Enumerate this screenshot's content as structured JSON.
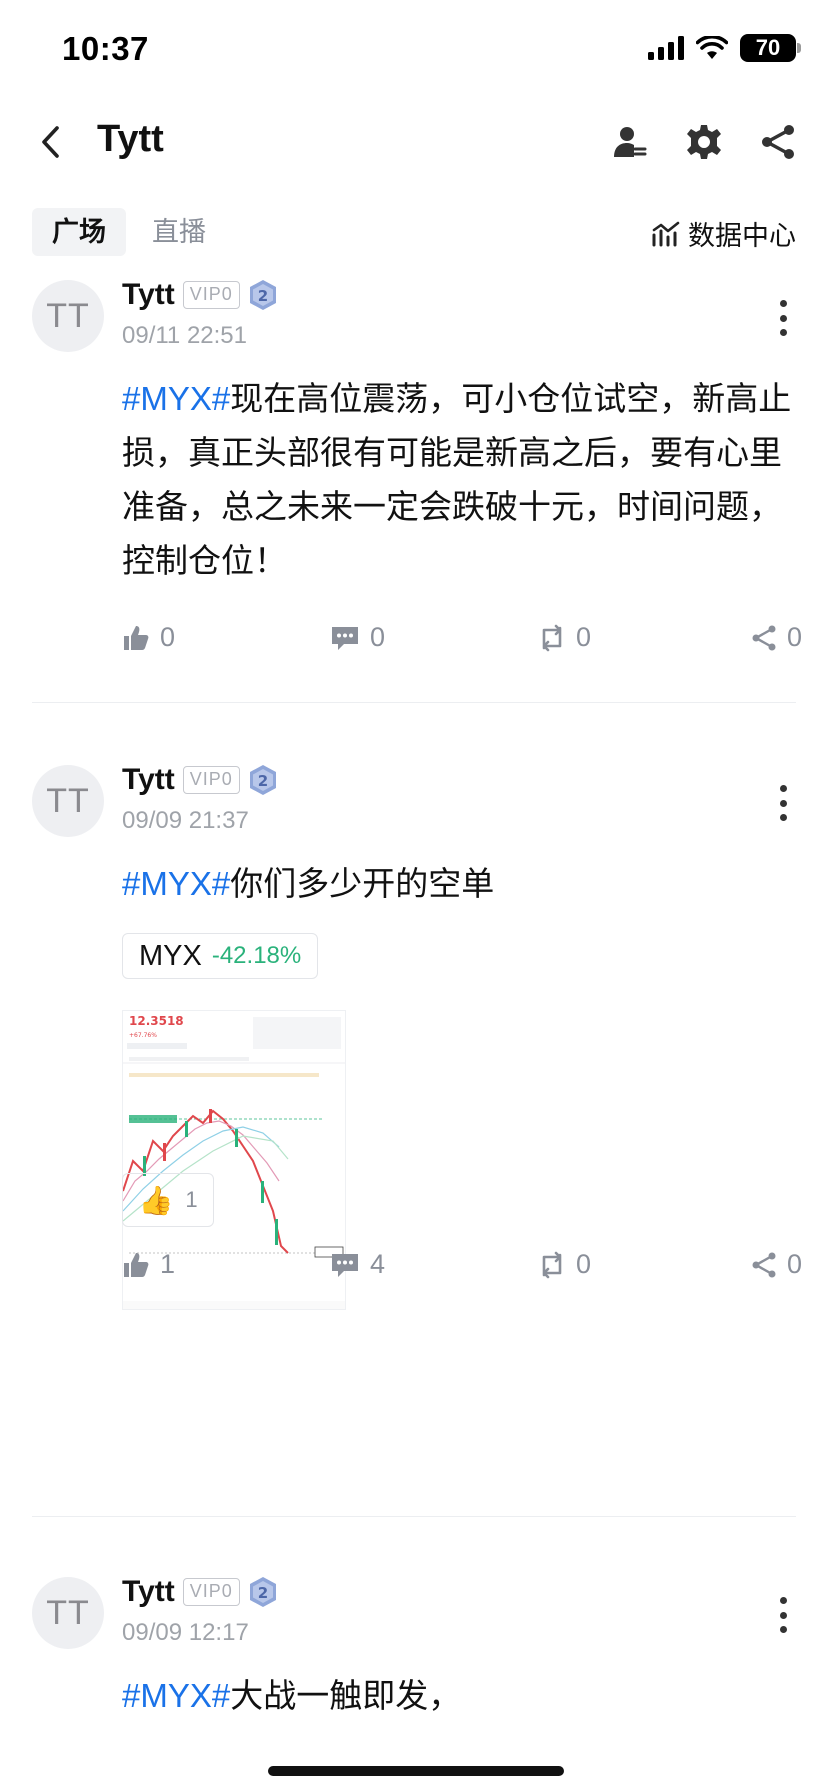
{
  "status_bar": {
    "time": "10:37",
    "battery": "70"
  },
  "nav": {
    "title": "Tytt"
  },
  "tabs": [
    {
      "label": "广场",
      "active": true
    },
    {
      "label": "直播",
      "active": false
    }
  ],
  "data_center": {
    "label": "数据中心"
  },
  "posts": [
    {
      "avatar_text": "TT",
      "author": "Tytt",
      "vip": "VIP0",
      "level": "2",
      "time": "09/11 22:51",
      "hashtag": "#MYX#",
      "text": "现在高位震荡，可小仓位试空，新高止损，真正头部很有可能是新高之后，要有心里准备，总之未来一定会跌破十元，时间问题，控制仓位！",
      "likes": "0",
      "comments": "0",
      "reposts": "0",
      "shares": "0"
    },
    {
      "avatar_text": "TT",
      "author": "Tytt",
      "vip": "VIP0",
      "level": "2",
      "time": "09/09 21:37",
      "hashtag": "#MYX#",
      "text": "你们多少开的空单",
      "ticker": {
        "symbol": "MYX",
        "change": "-42.18%"
      },
      "chart_price": "12.3518",
      "chart_change": "+67.76%",
      "reaction": {
        "emoji": "👍",
        "count": "1"
      },
      "likes": "1",
      "comments": "4",
      "reposts": "0",
      "shares": "0"
    },
    {
      "avatar_text": "TT",
      "author": "Tytt",
      "vip": "VIP0",
      "level": "2",
      "time": "09/09 12:17",
      "hashtag": "#MYX#",
      "text": "大战一触即发，"
    }
  ],
  "colors": {
    "hashtag": "#1a72e8",
    "positive_change": "#2ab27b",
    "muted": "#8a8f99",
    "level_badge": "#8fa6d9"
  }
}
